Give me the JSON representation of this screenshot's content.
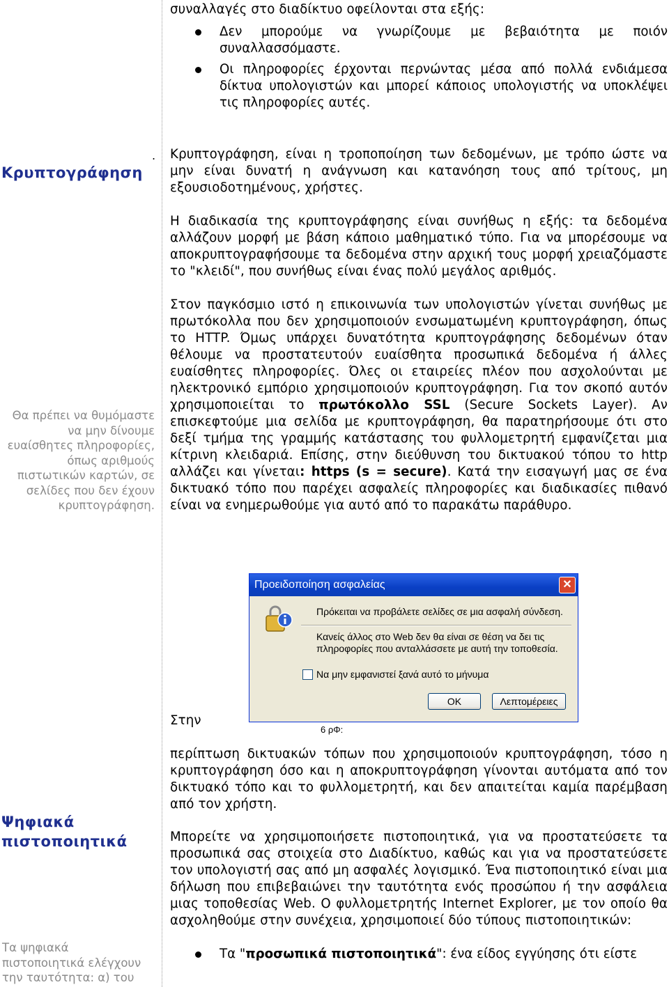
{
  "top": {
    "intro": "συναλλαγές στο διαδίκτυο  οφείλονται στα εξής:",
    "bullets": [
      "Δεν μπορούμε να γνωρίζουμε με βεβαιότητα με ποιόν συναλλασσόμαστε.",
      "Οι πληροφορίες έρχονται περνώντας μέσα από πολλά ενδιάμεσα δίκτυα υπολογιστών και μπορεί κάποιος υπολογιστής να υποκλέψει τις πληροφορίες αυτές."
    ]
  },
  "section1": {
    "dot": ".",
    "heading": "Κρυπτογράφηση",
    "p1": "Κρυπτογράφηση, είναι η τροποποίηση των δεδομένων, με τρόπο ώστε να μην είναι δυνατή η ανάγνωση και κατανόηση τους από τρίτους, μη εξουσιοδοτημένους, χρήστες.",
    "p2": "Η διαδικασία της κρυπτογράφησης είναι συνήθως η εξής: τα δεδομένα αλλάζουν μορφή με βάση κάποιο μαθηματικό τύπο. Για να μπορέσουμε να αποκρυπτογραφήσουμε τα δεδομένα στην αρχική τους μορφή χρειαζόμαστε το \"κλειδί\", που συνήθως είναι ένας πολύ μεγάλος αριθμός.",
    "p3_a": "Στον παγκόσμιο ιστό η επικοινωνία των υπολογιστών γίνεται συνήθως με πρωτόκολλα που δεν χρησιμοποιούν ενσωματωμένη κρυπτογράφηση, όπως το HTTP. Όμως υπάρχει δυνατότητα κρυπτογράφησης δεδομένων όταν θέλουμε να προστατευτούν ευαίσθητα προσωπικά δεδομένα ή άλλες ευαίσθητες πληροφορίες. Όλες οι εταιρείες πλέον που ασχολούνται με ηλεκτρονικό εμπόριο χρησιμοποιούν κρυπτογράφηση. Για τον σκοπό αυτόν χρησιμοποιείται το ",
    "p3_b": "πρωτόκολλο SSL",
    "p3_c": " (Secure Sockets Layer). Αν επισκεφτούμε μια σελίδα με κρυπτογράφηση, θα παρατηρήσουμε ότι στο δεξί τμήμα της γραμμής κατάστασης του φυλλομετρητή εμφανίζεται μια κίτρινη κλειδαριά. Επίσης, στην διεύθυνση του δικτυακού τόπου το http αλλάζει και γίνεται",
    "p3_d": ": https (s = secure)",
    "p3_e": ". Κατά την εισαγωγή μας σε ένα δικτυακό τόπο που παρέχει ασφαλείς πληροφορίες και διαδικασίες πιθανό είναι να ενημερωθούμε για αυτό από το παρακάτω παράθυρο.",
    "sidenote": "Θα πρέπει να θυμόμαστε να μην δίνουμε ευαίσθητες πληροφορίες, όπως αριθμούς πιστωτικών καρτών, σε σελίδες που δεν έχουν κρυπτογράφηση."
  },
  "dialog": {
    "title": "Προειδοποίηση ασφαλείας",
    "close": "✕",
    "message1": "Πρόκειται να προβάλετε σελίδες σε μια ασφαλή σύνδεση.",
    "message2": "Κανείς άλλος στο Web δεν θα είναι σε θέση να δει τις πληροφορίες που ανταλλάσσετε με αυτή την τοποθεσία.",
    "checkbox_label": "Να μην εμφανιστεί ξανά αυτό το μήνυμα",
    "ok": "OK",
    "details": "Λεπτομέρειες",
    "caption": "6 ρΦ:"
  },
  "section2": {
    "stin": "Στην",
    "p1": "περίπτωση δικτυακών τόπων που χρησιμοποιούν κρυπτογράφηση, τόσο η κρυπτογράφηση όσο και η αποκρυπτογράφηση γίνονται αυτόματα από τον δικτυακό τόπο και το φυλλομετρητή, και δεν απαιτείται καμία παρέμβαση από τον χρήστη."
  },
  "section3": {
    "heading": "Ψηφιακά πιστοποιητικά",
    "p1": "Μπορείτε να χρησιμοποιήσετε πιστοποιητικά, για να προστατεύσετε τα προσωπικά σας στοιχεία στο Διαδίκτυο, καθώς και για να προστατεύσετε τον υπολογιστή σας από μη ασφαλές λογισμικό. Ένα πιστοποιητικό είναι μια δήλωση που επιβεβαιώνει την ταυτότητα ενός προσώπου ή την ασφάλεια μιας τοποθεσίας Web. Ο φυλλομετρητής Internet Explorer, με τον οποίο θα ασχοληθούμε στην συνέχεια, χρησιμοποιεί δύο τύπους πιστοποιητικών:",
    "bullet_a": "Τα \"",
    "bullet_b": "προσωπικά πιστοποιητικά",
    "bullet_c": "\": ένα είδος εγγύησης ότι είστε",
    "sidenote": "Τα ψηφιακά πιστοποιητικά ελέγχουν την ταυτότητα: α) του"
  }
}
